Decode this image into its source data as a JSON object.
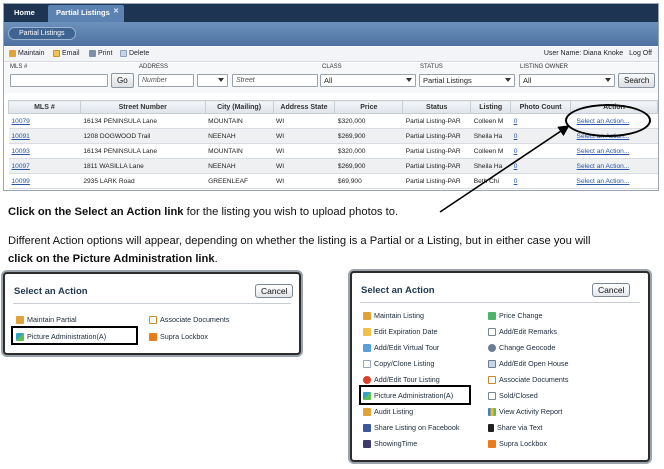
{
  "app": {
    "tabs": [
      "Home",
      "Partial Listings"
    ],
    "tab_close": "✕",
    "sub_tab": "Partial Listings",
    "toolbar": [
      {
        "label": "Maintain",
        "icon": "pencil-icon"
      },
      {
        "label": "Email",
        "icon": "email-icon"
      },
      {
        "label": "Print",
        "icon": "print-icon"
      },
      {
        "label": "Delete",
        "icon": "delete-icon"
      }
    ],
    "user_name": "User Name: Diana Knoke",
    "logoff": "Log Off",
    "filters": {
      "mls_label": "MLS #",
      "mls_value": "",
      "go": "Go",
      "address_label": "ADDRESS",
      "number_placeholder": "Number",
      "direction_value": "",
      "street_placeholder": "Street",
      "class_label": "CLASS",
      "class_value": "All",
      "status_label": "STATUS",
      "status_value": "Partial Listings",
      "owner_label": "LISTING OWNER",
      "owner_value": "All",
      "search": "Search"
    },
    "columns": [
      "MLS #",
      "Street Number",
      "City (Mailing)",
      "Address State",
      "Price",
      "Status",
      "Listing",
      "Photo Count",
      "Action"
    ],
    "rows": [
      {
        "mls": "10079",
        "street": "16134 PENINSULA Lane",
        "city": "MOUNTAIN",
        "state": "WI",
        "price": "$320,000",
        "status": "Partial Listing-PAR",
        "agent": "Colleen M",
        "photos": "0",
        "action": "Select an Action..."
      },
      {
        "mls": "10091",
        "street": "1208 DOGWOOD Trail",
        "city": "NEENAH",
        "state": "WI",
        "price": "$269,900",
        "status": "Partial Listing-PAR",
        "agent": "Sheila Ha",
        "photos": "0",
        "action": "Select an Action..."
      },
      {
        "mls": "10093",
        "street": "16134 PENINSULA Lane",
        "city": "MOUNTAIN",
        "state": "WI",
        "price": "$320,000",
        "status": "Partial Listing-PAR",
        "agent": "Colleen M",
        "photos": "0",
        "action": "Select an Action..."
      },
      {
        "mls": "10097",
        "street": "1811 WASILLA Lane",
        "city": "NEENAH",
        "state": "WI",
        "price": "$269,900",
        "status": "Partial Listing-PAR",
        "agent": "Sheila Ha",
        "photos": "0",
        "action": "Select an Action..."
      },
      {
        "mls": "10099",
        "street": "2935 LARK Road",
        "city": "GREENLEAF",
        "state": "WI",
        "price": "$69,900",
        "status": "Partial Listing-PAR",
        "agent": "Beth Chi",
        "photos": "0",
        "action": "Select an Action..."
      }
    ]
  },
  "instructions": {
    "line1_bold": "Click on the Select an Action link",
    "line1_rest": " for the listing you wish to upload photos to.",
    "line2": "Different Action options will appear, depending on whether the listing is a Partial or a Listing, but in either case you will",
    "line3_bold": "click on the Picture Administration link",
    "line3_rest": "."
  },
  "dialog_partial": {
    "title": "Select an Action",
    "cancel": "Cancel",
    "left": [
      {
        "label": "Maintain Partial",
        "icon": "pencil-icon"
      },
      {
        "label": "Picture Administration(A)",
        "icon": "picture-icon"
      }
    ],
    "right": [
      {
        "label": "Associate Documents",
        "icon": "document-icon"
      },
      {
        "label": "Supra Lockbox",
        "icon": "lockbox-icon"
      }
    ]
  },
  "dialog_listing": {
    "title": "Select an Action",
    "cancel": "Cancel",
    "left": [
      {
        "label": "Maintain Listing",
        "icon": "pencil-icon"
      },
      {
        "label": "Edit Expiration Date",
        "icon": "calendar-icon"
      },
      {
        "label": "Add/Edit Virtual Tour",
        "icon": "tour-icon"
      },
      {
        "label": "Copy/Clone Listing",
        "icon": "copy-icon"
      },
      {
        "label": "Add/Edit Tour Listing",
        "icon": "tour-listing-icon"
      },
      {
        "label": "Picture Administration(A)",
        "icon": "picture-icon"
      },
      {
        "label": "Audit Listing",
        "icon": "audit-icon"
      },
      {
        "label": "Share Listing on Facebook",
        "icon": "facebook-icon"
      },
      {
        "label": "ShowingTime",
        "icon": "showingtime-icon"
      }
    ],
    "right": [
      {
        "label": "Price Change",
        "icon": "price-icon"
      },
      {
        "label": "Add/Edit Remarks",
        "icon": "remarks-icon"
      },
      {
        "label": "Change Geocode",
        "icon": "geocode-icon"
      },
      {
        "label": "Add/Edit Open House",
        "icon": "open-house-icon"
      },
      {
        "label": "Associate Documents",
        "icon": "document-icon"
      },
      {
        "label": "Sold/Closed",
        "icon": "sold-icon"
      },
      {
        "label": "View Activity Report",
        "icon": "chart-icon"
      },
      {
        "label": "Share via Text",
        "icon": "phone-icon"
      },
      {
        "label": "Supra Lockbox",
        "icon": "lockbox-icon"
      }
    ]
  },
  "colors": {
    "nav_dark": "#1d3553",
    "nav_blue": "#5b82b0",
    "link": "#2a55a8"
  }
}
